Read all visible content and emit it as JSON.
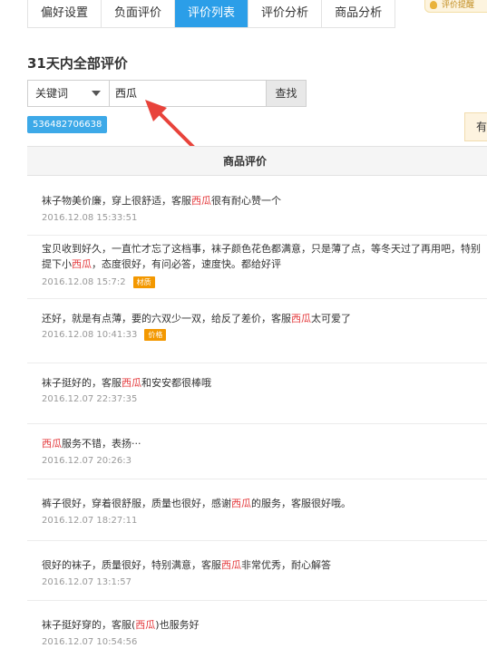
{
  "tabs": [
    {
      "label": "偏好设置",
      "active": false
    },
    {
      "label": "负面评价",
      "active": false
    },
    {
      "label": "评价列表",
      "active": true
    },
    {
      "label": "评价分析",
      "active": false
    },
    {
      "label": "商品分析",
      "active": false
    }
  ],
  "tip": {
    "text": "评价提醒"
  },
  "section_title": "31天内全部评价",
  "search": {
    "select_value": "关键词",
    "input_value": "西瓜",
    "button_label": "查找"
  },
  "item_id": "536482706638",
  "side_button": "有",
  "table": {
    "header": "商品评价"
  },
  "reviews": [
    {
      "pre": "袜子物美价廉，穿上很舒适，客服",
      "kw": "西瓜",
      "post": "很有耐心赞一个",
      "time": "2016.12.08 15:33:51",
      "tag": ""
    },
    {
      "pre": "宝贝收到好久，一直忙才忘了这档事，袜子颜色花色都满意，只是薄了点，等冬天过了再用吧，特别提下小",
      "kw": "西瓜",
      "post": "，态度很好，有问必答，速度快。都给好评",
      "time": "2016.12.08 15:7:2",
      "tag": "材质"
    },
    {
      "pre": "还好，就是有点薄，要的六双少一双，给反了差价，客服",
      "kw": "西瓜",
      "post": "太可爱了",
      "time": "2016.12.08 10:41:33",
      "tag": "价格"
    },
    {
      "pre": "袜子挺好的，客服",
      "kw": "西瓜",
      "post": "和安安都很棒哦",
      "time": "2016.12.07 22:37:35",
      "tag": ""
    },
    {
      "pre": "",
      "kw": "西瓜",
      "post": "服务不错，表扬···",
      "time": "2016.12.07 20:26:3",
      "tag": ""
    },
    {
      "pre": "裤子很好，穿着很舒服，质量也很好，感谢",
      "kw": "西瓜",
      "post": "的服务，客服很好哦。",
      "time": "2016.12.07 18:27:11",
      "tag": ""
    },
    {
      "pre": "很好的袜子，质量很好，特别满意，客服",
      "kw": "西瓜",
      "post": "非常优秀，耐心解答",
      "time": "2016.12.07 13:1:57",
      "tag": ""
    },
    {
      "pre": "袜子挺好穿的，客服(",
      "kw": "西瓜",
      "post": ")也服务好",
      "time": "2016.12.07 10:54:56",
      "tag": ""
    }
  ]
}
